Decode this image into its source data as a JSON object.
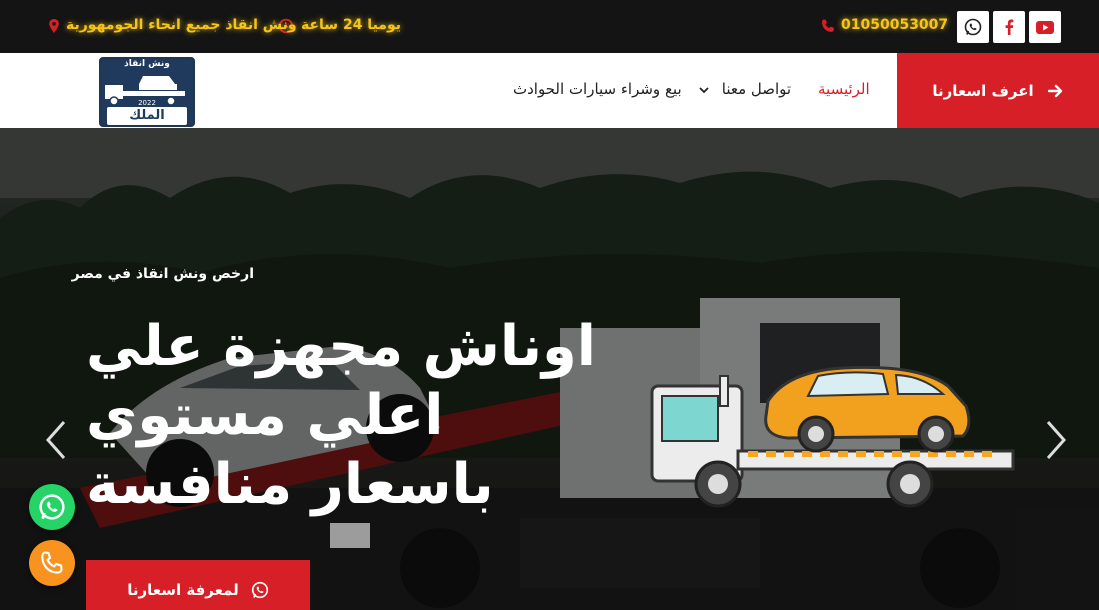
{
  "topbar": {
    "phone": "01050053007",
    "hours": "يوميا 24 ساعة",
    "location": "ونش انقاذ جميع انحاء الجومهورية",
    "socials": [
      "youtube-icon",
      "facebook-icon",
      "whatsapp-icon"
    ],
    "text_color": "#f5c518"
  },
  "nav": {
    "cta_label": "اعرف اسعارنا",
    "items": [
      {
        "label": "الرئيسية",
        "active": true
      },
      {
        "label": "تواصل معنا",
        "has_dropdown": true
      },
      {
        "label": "بيع وشراء سيارات الحوادث"
      }
    ],
    "logo": {
      "top_text": "ونش انقاذ",
      "year": "2022",
      "bottom_text": "الملك"
    }
  },
  "hero": {
    "tagline": "ارخص ونش انقاذ في مصر",
    "headline": "اوناش مجهزة علي اعلي مستوي باسعار منافسة",
    "button_label": "لمعرفة اسعارنا"
  },
  "colors": {
    "accent": "#d61f26",
    "dark": "#141414",
    "whatsapp": "#25d366",
    "call": "#f7931e"
  }
}
